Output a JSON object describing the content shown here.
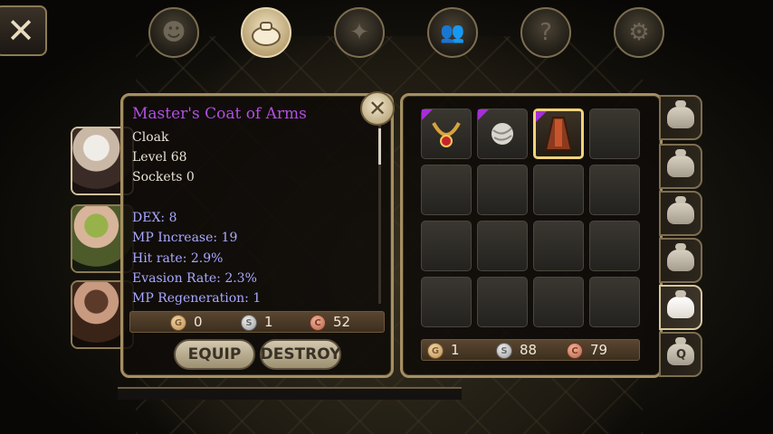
{
  "nav": {
    "close_label": "✕",
    "tabs": [
      {
        "icon": "character-head-icon",
        "glyph": "☻"
      },
      {
        "icon": "inventory-bag-icon",
        "glyph": "💰",
        "active": true
      },
      {
        "icon": "skills-compass-icon",
        "glyph": "✦"
      },
      {
        "icon": "party-people-icon",
        "glyph": "👪"
      },
      {
        "icon": "quest-scroll-icon",
        "glyph": "?"
      },
      {
        "icon": "settings-gear-icon",
        "glyph": "⚙"
      }
    ]
  },
  "item": {
    "name": "Master's Coat of Arms",
    "name_color": "#b24fe0",
    "type": "Cloak",
    "level": "Level 68",
    "sockets": "Sockets 0",
    "stats": [
      "DEX: 8",
      "MP Increase: 19",
      "Hit rate: 2.9%",
      "Evasion Rate: 2.3%",
      "MP Regeneration: 1"
    ],
    "price": {
      "gold": "0",
      "silver": "1",
      "copper": "52"
    },
    "equip_label": "EQUIP",
    "destroy_label": "DESTROY",
    "close_label": "✕"
  },
  "inventory": {
    "slots": [
      {
        "item": "necklace",
        "corner": true
      },
      {
        "item": "bandage-ball",
        "corner": true
      },
      {
        "item": "cloak",
        "corner": true,
        "selected": true
      },
      {
        "item": null
      },
      {
        "item": null
      },
      {
        "item": null
      },
      {
        "item": null
      },
      {
        "item": null
      },
      {
        "item": null
      },
      {
        "item": null
      },
      {
        "item": null
      },
      {
        "item": null
      },
      {
        "item": null
      },
      {
        "item": null
      },
      {
        "item": null
      },
      {
        "item": null
      }
    ],
    "money": {
      "gold": "1",
      "silver": "88",
      "copper": "79"
    },
    "coin_letters": {
      "gold": "G",
      "silver": "S",
      "copper": "C"
    }
  },
  "side_tabs": [
    {
      "icon": "bag-icon"
    },
    {
      "icon": "bag-icon"
    },
    {
      "icon": "bag-icon"
    },
    {
      "icon": "bag-icon"
    },
    {
      "icon": "bag-icon",
      "active": true
    },
    {
      "icon": "quest-bag-icon",
      "label": "Q"
    }
  ],
  "colors": {
    "panel_border": "#a58f62",
    "stat_text": "#a9a9ff",
    "rarity": "#a530d6",
    "selected_border": "#f1d27b"
  }
}
